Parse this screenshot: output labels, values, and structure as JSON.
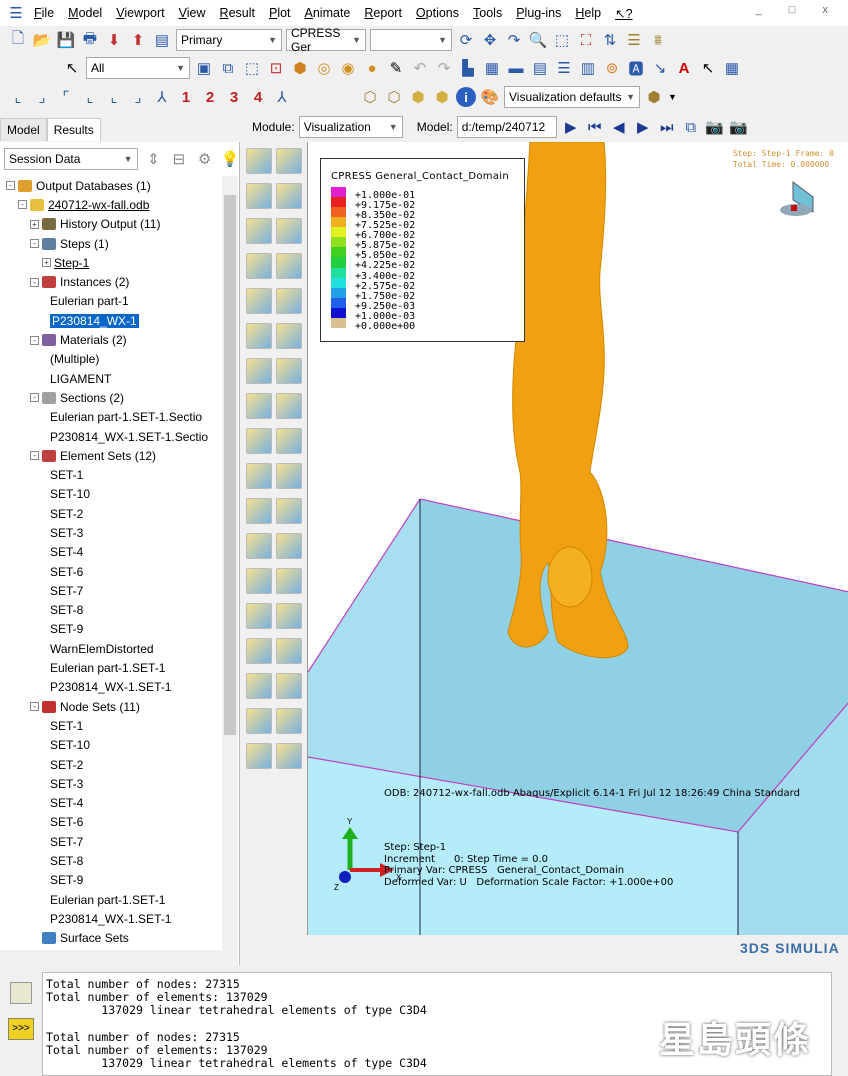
{
  "menu": [
    "File",
    "Model",
    "Viewport",
    "View",
    "Result",
    "Plot",
    "Animate",
    "Report",
    "Options",
    "Tools",
    "Plug-ins",
    "Help",
    "↖?"
  ],
  "window_controls": "_ □ x",
  "toolbar1": {
    "step_select": "Primary",
    "variable_select": "CPRESS  Ger",
    "blank_select": ""
  },
  "toolbar2": {
    "selection_filter": "All"
  },
  "toolbar3": {
    "view_numbers": [
      "1",
      "2",
      "3",
      "4"
    ],
    "display_options": "Visualization defaults"
  },
  "context": {
    "module_label": "Module:",
    "module_value": "Visualization",
    "model_label": "Model:",
    "model_value": "d:/temp/240712"
  },
  "left_tabs": [
    "Model",
    "Results"
  ],
  "session": "Session Data",
  "tree": [
    {
      "label": "Output Databases (1)",
      "level": 0,
      "exp": "-",
      "icon": "#e0a030"
    },
    {
      "label": "240712-wx-fall.odb",
      "level": 1,
      "exp": "-",
      "icon": "#e8c040",
      "ul": true
    },
    {
      "label": "History Output (11)",
      "level": 2,
      "exp": "+",
      "icon": "#7a6a40"
    },
    {
      "label": "Steps (1)",
      "level": 2,
      "exp": "-",
      "icon": "#6080a0"
    },
    {
      "label": "Step-1",
      "level": 3,
      "exp": "+",
      "ul": true
    },
    {
      "label": "Instances (2)",
      "level": 2,
      "exp": "-",
      "icon": "#c04040"
    },
    {
      "label": "Eulerian part-1",
      "level": 3
    },
    {
      "label": "P230814_WX-1",
      "level": 3,
      "selected": true
    },
    {
      "label": "Materials (2)",
      "level": 2,
      "exp": "-",
      "icon": "#8060a0"
    },
    {
      "label": "(Multiple)",
      "level": 3
    },
    {
      "label": "LIGAMENT",
      "level": 3
    },
    {
      "label": "Sections (2)",
      "level": 2,
      "exp": "-",
      "icon": "#a0a0a0"
    },
    {
      "label": "Eulerian part-1.SET-1.Sectio",
      "level": 3
    },
    {
      "label": "P230814_WX-1.SET-1.Sectio",
      "level": 3
    },
    {
      "label": "Element Sets (12)",
      "level": 2,
      "exp": "-",
      "icon": "#c04040"
    },
    {
      "label": "SET-1",
      "level": 3
    },
    {
      "label": "SET-10",
      "level": 3
    },
    {
      "label": "SET-2",
      "level": 3
    },
    {
      "label": "SET-3",
      "level": 3
    },
    {
      "label": "SET-4",
      "level": 3
    },
    {
      "label": "SET-6",
      "level": 3
    },
    {
      "label": "SET-7",
      "level": 3
    },
    {
      "label": "SET-8",
      "level": 3
    },
    {
      "label": "SET-9",
      "level": 3
    },
    {
      "label": "WarnElemDistorted",
      "level": 3
    },
    {
      "label": "Eulerian part-1.SET-1",
      "level": 3
    },
    {
      "label": "P230814_WX-1.SET-1",
      "level": 3
    },
    {
      "label": "Node Sets (11)",
      "level": 2,
      "exp": "-",
      "icon": "#c03030"
    },
    {
      "label": "SET-1",
      "level": 3
    },
    {
      "label": "SET-10",
      "level": 3
    },
    {
      "label": "SET-2",
      "level": 3
    },
    {
      "label": "SET-3",
      "level": 3
    },
    {
      "label": "SET-4",
      "level": 3
    },
    {
      "label": "SET-6",
      "level": 3
    },
    {
      "label": "SET-7",
      "level": 3
    },
    {
      "label": "SET-8",
      "level": 3
    },
    {
      "label": "SET-9",
      "level": 3
    },
    {
      "label": "Eulerian part-1.SET-1",
      "level": 3
    },
    {
      "label": "P230814_WX-1.SET-1",
      "level": 3
    },
    {
      "label": "Surface Sets",
      "level": 2,
      "icon": "#4080c0"
    }
  ],
  "legend": {
    "title": "CPRESS   General_Contact_Domain",
    "colors": [
      "#e020d0",
      "#e82020",
      "#f06020",
      "#f0b020",
      "#e0f020",
      "#90e020",
      "#40d020",
      "#20d040",
      "#20e0a0",
      "#20e0e0",
      "#20a0e8",
      "#2060e8",
      "#1010d0",
      "#d8c090"
    ],
    "values": [
      "+1.000e-01",
      "+9.175e-02",
      "+8.350e-02",
      "+7.525e-02",
      "+6.700e-02",
      "+5.875e-02",
      "+5.050e-02",
      "+4.225e-02",
      "+3.400e-02",
      "+2.575e-02",
      "+1.750e-02",
      "+9.250e-03",
      "+1.000e-03",
      "+0.000e+00"
    ]
  },
  "step_info": {
    "line1": "Step: Step-1   Frame: 0",
    "line2": "Total Time: 0.000000"
  },
  "odb_line": "ODB: 240712-wx-fall.odb    Abaqus/Explicit 6.14-1    Fri Jul 12 18:26:49 China Standard",
  "state_block": "Step: Step-1\nIncrement      0: Step Time = 0.0\nPrimary Var: CPRESS   General_Contact_Domain\nDeformed Var: U   Deformation Scale Factor: +1.000e+00",
  "triad": {
    "x": "X",
    "y": "Y",
    "z": "Z"
  },
  "brand": "3DS SIMULIA",
  "messages": "Total number of nodes: 27315\nTotal number of elements: 137029\n        137029 linear tetrahedral elements of type C3D4\n\nTotal number of nodes: 27315\nTotal number of elements: 137029\n        137029 linear tetrahedral elements of type C3D4",
  "watermark": "星島頭條",
  "colors": {
    "model": "#f0a010",
    "floor": "#a8e4f4",
    "accent": "#0a66c8"
  }
}
